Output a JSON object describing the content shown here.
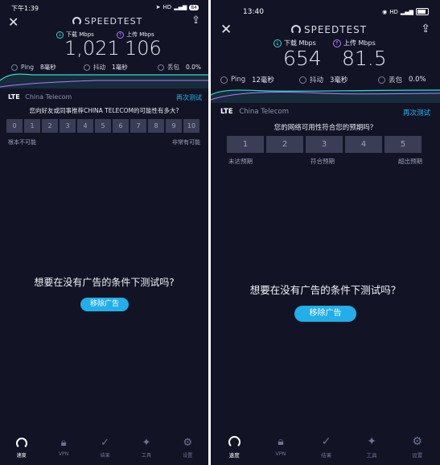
{
  "left": {
    "status": {
      "time": "下午1:39",
      "battery": "84"
    },
    "app": {
      "logo": "SPEEDTEST"
    },
    "download": {
      "label": "下载 Mbps",
      "value": "1,021"
    },
    "upload": {
      "label": "上传 Mbps",
      "value": "106"
    },
    "ping": {
      "label": "Ping",
      "value": "8毫秒"
    },
    "jitter": {
      "label": "抖动",
      "value": "1毫秒"
    },
    "loss": {
      "label": "丢包",
      "value": "0.0%"
    },
    "network": {
      "type": "LTE",
      "carrier": "China Telecom",
      "retest": "再次测试"
    },
    "survey": {
      "question": "您向好友或同事推荐CHINA TELECOM的可能性有多大?",
      "options": [
        "0",
        "1",
        "2",
        "3",
        "4",
        "5",
        "6",
        "7",
        "8",
        "9",
        "10"
      ],
      "left_label": "根本不可能",
      "right_label": "非常有可能"
    },
    "ad": {
      "text": "想要在没有广告的条件下测试吗?",
      "button": "移除广告"
    },
    "nav": [
      "速度",
      "VPN",
      "结果",
      "工具",
      "设置"
    ]
  },
  "right": {
    "status": {
      "time": "13:40",
      "network": "HD"
    },
    "app": {
      "logo": "SPEEDTEST"
    },
    "download": {
      "label": "下载 Mbps",
      "value": "654"
    },
    "upload": {
      "label": "上传 Mbps",
      "value": "81.5"
    },
    "ping": {
      "label": "Ping",
      "value": "12毫秒"
    },
    "jitter": {
      "label": "抖动",
      "value": "3毫秒"
    },
    "loss": {
      "label": "丢包",
      "value": "0.0%"
    },
    "network": {
      "type": "LTE",
      "carrier": "China Telecom",
      "retest": "再次测试"
    },
    "survey": {
      "question": "您的网络可用性符合您的预期吗？",
      "options": [
        "1",
        "2",
        "3",
        "4",
        "5"
      ],
      "left_label": "未达预期",
      "mid_label": "符合预期",
      "right_label": "超出预期"
    },
    "ad": {
      "text": "想要在没有广告的条件下测试吗？",
      "button": "移除广告"
    },
    "nav": [
      "速度",
      "VPN",
      "结果",
      "工具",
      "设置"
    ]
  },
  "colors": {
    "background": "#121426",
    "accent": "#22aee8",
    "download": "#38d6c8",
    "upload": "#b07bff"
  }
}
